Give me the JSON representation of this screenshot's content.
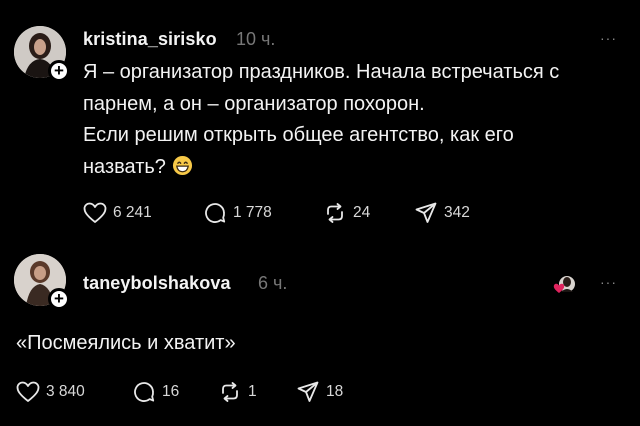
{
  "post": {
    "username": "kristina_sirisko",
    "time": "10 ч.",
    "more": "···",
    "lines": [
      "Я – организатор праздников. Начала встречаться с",
      "парнем, а он – организатор похорон.",
      "Если решим открыть общее агентство, как его",
      "назвать?"
    ],
    "emoji": "grinning-face-emoji",
    "likes": "6 241",
    "comments": "1 778",
    "reposts": "24",
    "shares": "342"
  },
  "reply": {
    "username": "taneybolshakova",
    "time": "6 ч.",
    "more": "···",
    "text": "«Посмеялись и хватит»",
    "likes": "3 840",
    "comments": "16",
    "reposts": "1",
    "shares": "18"
  },
  "colors": {
    "background": "#000000",
    "text": "#f3f3f3",
    "muted": "#777777",
    "heart": "#e0245e",
    "emoji": "#f7c948"
  },
  "icons": [
    "heart-icon",
    "comment-icon",
    "repost-icon",
    "share-icon",
    "more-icon",
    "plus-icon"
  ]
}
